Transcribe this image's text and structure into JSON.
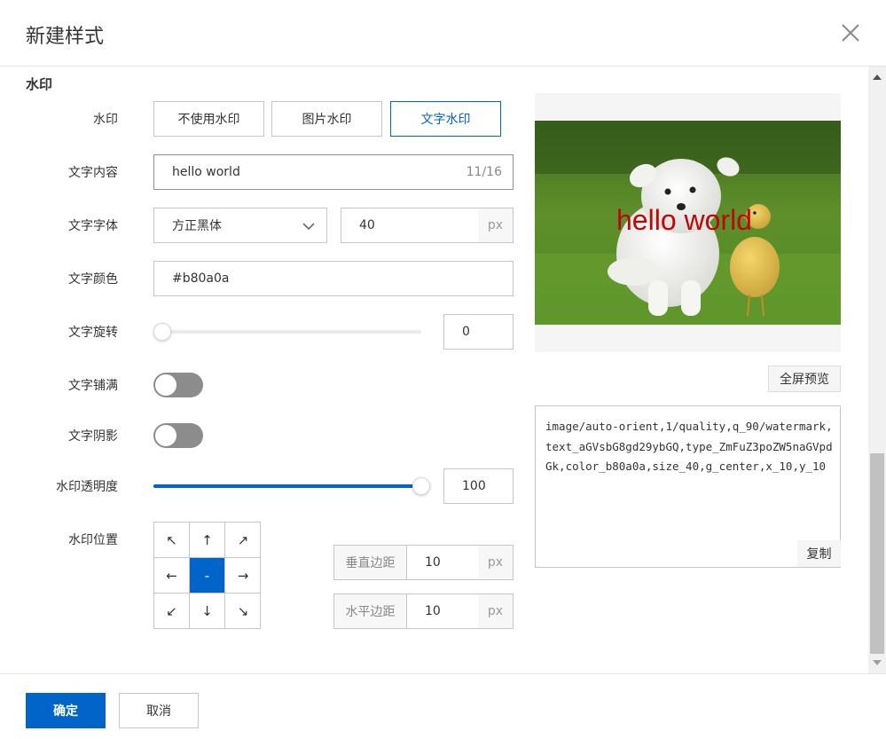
{
  "dialog": {
    "title": "新建样式"
  },
  "section": {
    "title": "水印"
  },
  "watermark_type": {
    "label": "水印",
    "options": [
      "不使用水印",
      "图片水印",
      "文字水印"
    ],
    "selected": "文字水印"
  },
  "text_content": {
    "label": "文字内容",
    "value": "hello world",
    "counter": "11/16"
  },
  "text_font": {
    "label": "文字字体",
    "font_value": "方正黑体",
    "size_value": "40",
    "unit": "px"
  },
  "text_color": {
    "label": "文字颜色",
    "value": "#b80a0a"
  },
  "text_rotate": {
    "label": "文字旋转",
    "value": "0",
    "slider_fraction": 0
  },
  "text_fill": {
    "label": "文字铺满",
    "on": false
  },
  "text_shadow": {
    "label": "文字阴影",
    "on": false
  },
  "opacity": {
    "label": "水印透明度",
    "value": "100",
    "slider_fraction": 1
  },
  "position": {
    "label": "水印位置",
    "cells": [
      "↖",
      "↑",
      "↗",
      "←",
      "-",
      "→",
      "↙",
      "↓",
      "↘"
    ],
    "selected_index": 4,
    "vertical_margin": {
      "label": "垂直边距",
      "value": "10",
      "unit": "px"
    },
    "horizontal_margin": {
      "label": "水平边距",
      "value": "10",
      "unit": "px"
    }
  },
  "preview": {
    "watermark_text": "hello world",
    "watermark_color": "#b80a0a",
    "fullscreen_button": "全屏预览"
  },
  "code": {
    "text": "image/auto-orient,1/quality,q_90/watermark,text_aGVsbG8gd29ybGQ,type_ZmFuZ3poZW5naGVpdGk,color_b80a0a,size_40,g_center,x_10,y_10",
    "copy_button": "复制"
  },
  "footer": {
    "confirm": "确定",
    "cancel": "取消"
  },
  "colors": {
    "accent": "#0064c8",
    "watermark": "#b80a0a"
  }
}
